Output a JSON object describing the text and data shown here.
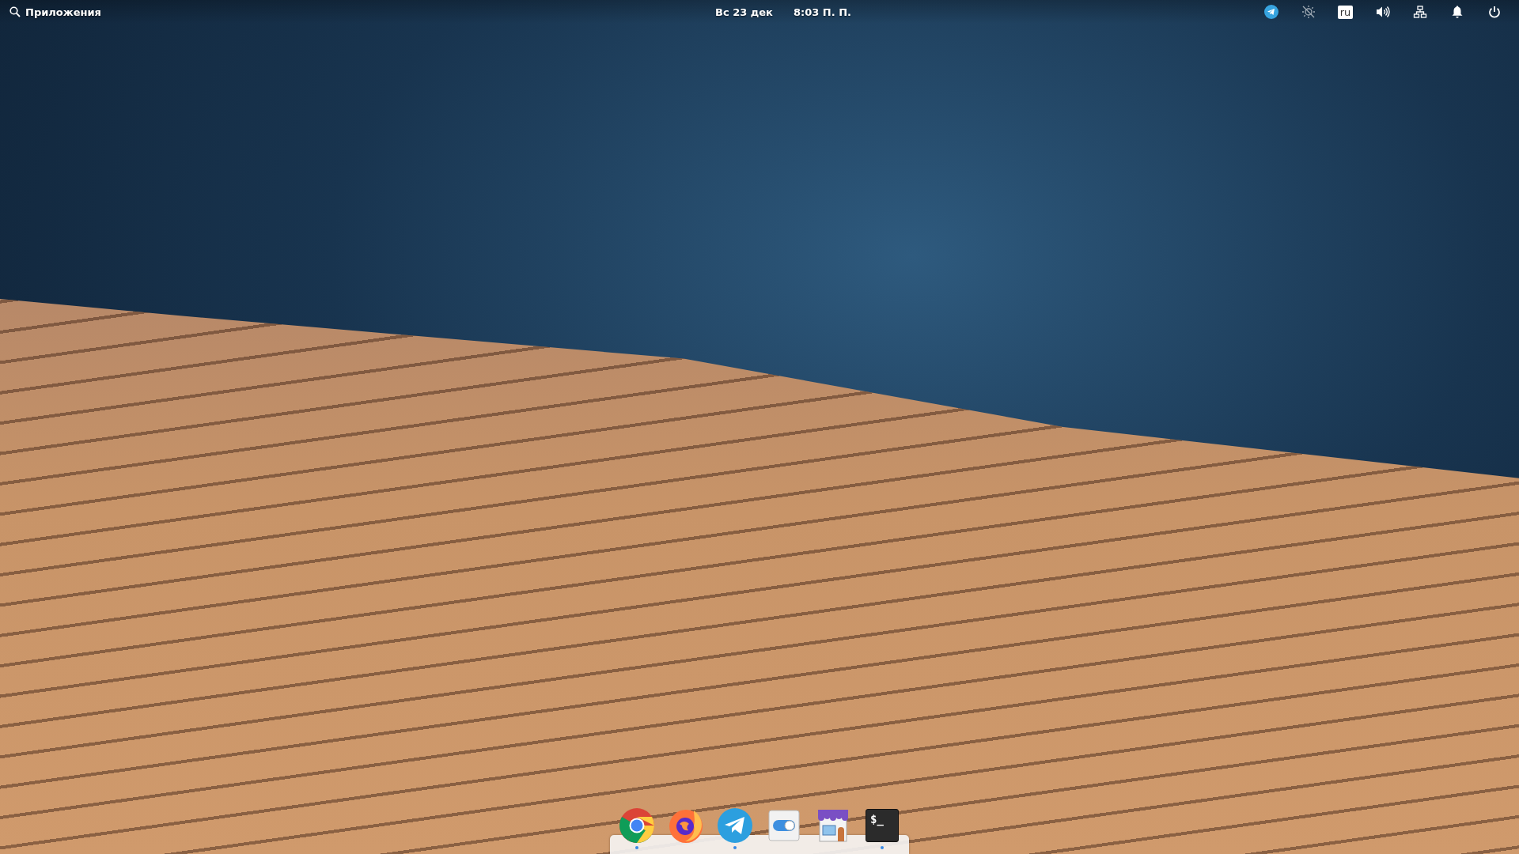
{
  "panel": {
    "applications_label": "Приложения",
    "date": "Вс 23 дек",
    "time": "8:03 П. П.",
    "indicators": [
      {
        "kind": "telegram"
      },
      {
        "kind": "nightlight"
      },
      {
        "kind": "keyboard",
        "label": "ru"
      },
      {
        "kind": "sound"
      },
      {
        "kind": "network"
      },
      {
        "kind": "notifications"
      },
      {
        "kind": "power"
      }
    ]
  },
  "dock": {
    "apps": [
      {
        "kind": "chrome",
        "running": true
      },
      {
        "kind": "firefox",
        "running": false
      },
      {
        "kind": "telegram",
        "running": true
      },
      {
        "kind": "switchboard",
        "running": false
      },
      {
        "kind": "appcenter",
        "running": false
      },
      {
        "kind": "terminal",
        "running": true,
        "glyph": "$_"
      }
    ]
  }
}
